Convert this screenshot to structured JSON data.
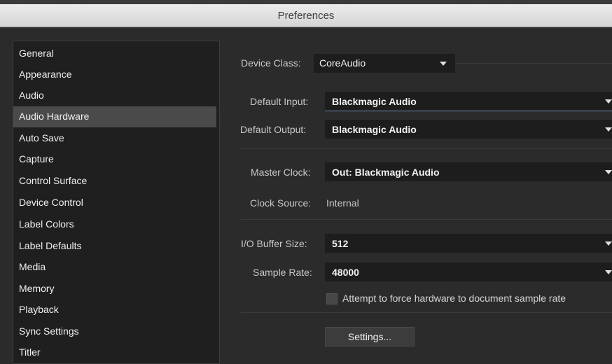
{
  "window": {
    "title": "Preferences"
  },
  "sidebar": {
    "items": [
      {
        "label": "General",
        "selected": false
      },
      {
        "label": "Appearance",
        "selected": false
      },
      {
        "label": "Audio",
        "selected": false
      },
      {
        "label": "Audio Hardware",
        "selected": true
      },
      {
        "label": "Auto Save",
        "selected": false
      },
      {
        "label": "Capture",
        "selected": false
      },
      {
        "label": "Control Surface",
        "selected": false
      },
      {
        "label": "Device Control",
        "selected": false
      },
      {
        "label": "Label Colors",
        "selected": false
      },
      {
        "label": "Label Defaults",
        "selected": false
      },
      {
        "label": "Media",
        "selected": false
      },
      {
        "label": "Memory",
        "selected": false
      },
      {
        "label": "Playback",
        "selected": false
      },
      {
        "label": "Sync Settings",
        "selected": false
      },
      {
        "label": "Titler",
        "selected": false
      }
    ]
  },
  "main": {
    "device_class": {
      "label": "Device Class:",
      "value": "CoreAudio"
    },
    "default_input": {
      "label": "Default Input:",
      "value": "Blackmagic Audio"
    },
    "default_output": {
      "label": "Default Output:",
      "value": "Blackmagic Audio"
    },
    "master_clock": {
      "label": "Master Clock:",
      "value": "Out: Blackmagic Audio"
    },
    "clock_source": {
      "label": "Clock Source:",
      "value": "Internal"
    },
    "io_buffer_size": {
      "label": "I/O Buffer Size:",
      "value": "512"
    },
    "sample_rate": {
      "label": "Sample Rate:",
      "value": "48000"
    },
    "force_sample_rate": {
      "label": "Attempt to force hardware to document sample rate",
      "checked": false
    },
    "settings_button": "Settings..."
  }
}
